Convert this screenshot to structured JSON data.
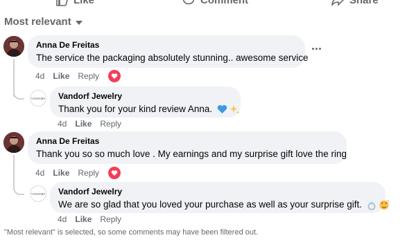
{
  "action_bar": {
    "like_label": "Like",
    "comment_label": "Comment",
    "share_label": "Share"
  },
  "sort": {
    "label": "Most relevant"
  },
  "comments": [
    {
      "author": "Anna De Freitas",
      "text": "The service the packaging absolutely stunning.. awesome service",
      "time": "4d",
      "like_label": "Like",
      "reply_label": "Reply",
      "reaction": "love",
      "reply": {
        "author": "Vandorf Jewelry",
        "text": "Thank you for your kind review Anna.",
        "emojis": [
          "blue-heart",
          "sparkles"
        ],
        "time": "4d",
        "like_label": "Like",
        "reply_label": "Reply"
      }
    },
    {
      "author": "Anna De Freitas",
      "text": "Thank you so so much love . My earnings and my surprise gift love the ring",
      "time": "4d",
      "like_label": "Like",
      "reply_label": "Reply",
      "reaction": "love",
      "reply": {
        "author": "Vandorf Jewelry",
        "text": "We are so glad that you loved your purchase as well as your surprise gift.",
        "emojis": [
          "ring",
          "face-with-hearts"
        ],
        "time": "4d",
        "like_label": "Like",
        "reply_label": "Reply"
      }
    }
  ],
  "footer": {
    "note": "\"Most relevant\" is selected, so some comments may have been filtered out."
  },
  "colors": {
    "bubble": "#f0f2f5",
    "muted": "#65676b",
    "love": "#f33e58"
  }
}
